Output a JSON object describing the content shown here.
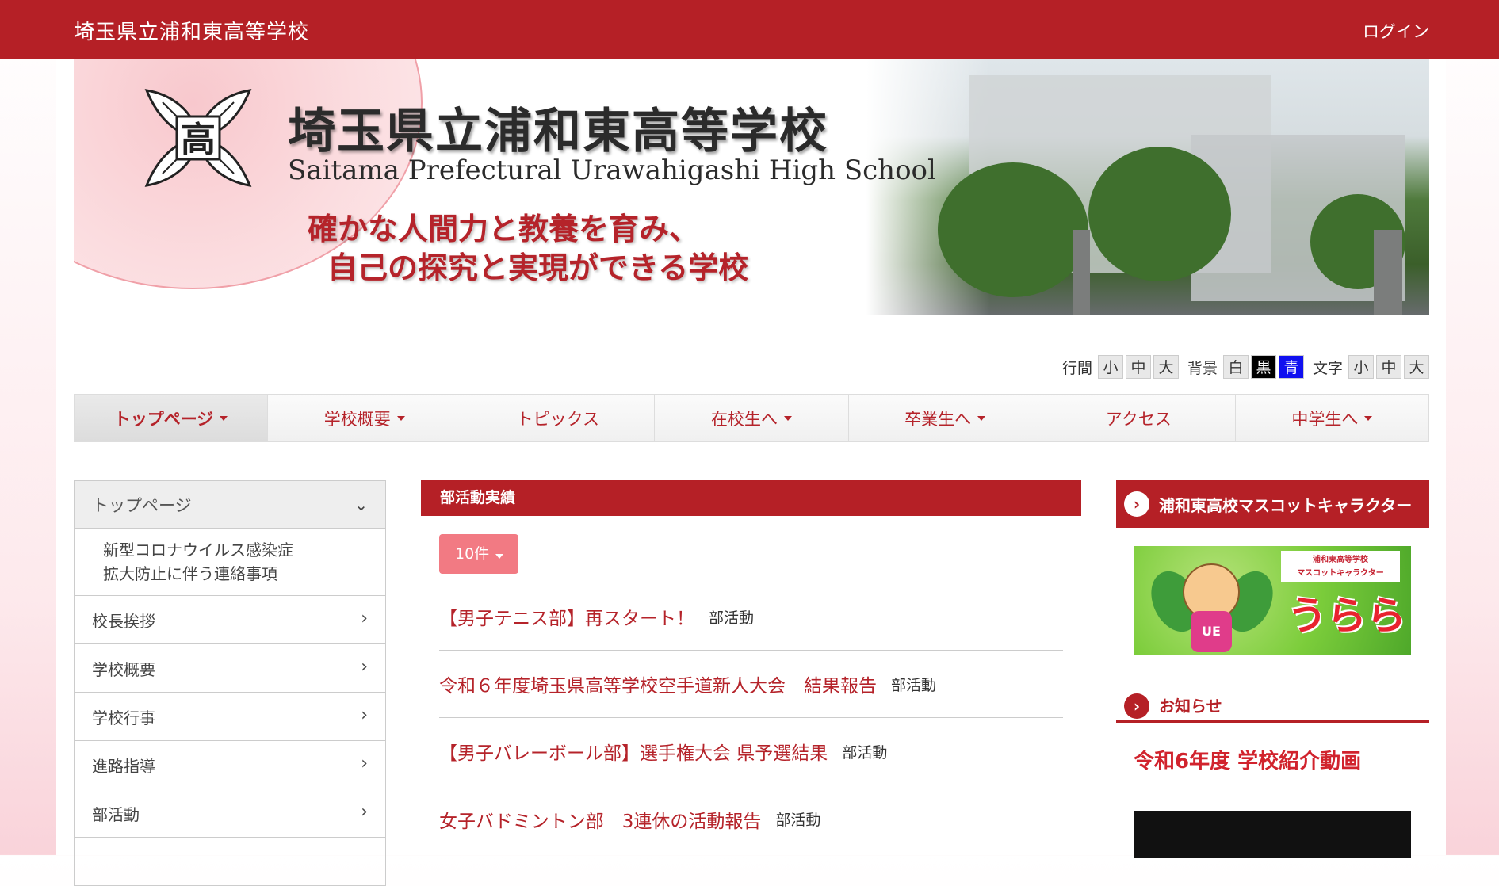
{
  "header": {
    "site_title": "埼玉県立浦和東高等学校",
    "login": "ログイン"
  },
  "banner": {
    "title_ja": "埼玉県立浦和東高等学校",
    "title_en": "Saitama Prefectural Urawahigashi High School",
    "motto_line1": "確かな人間力と教養を育み、",
    "motto_line2": "自己の探究と実現ができる学校",
    "emblem_char": "高"
  },
  "accessibility": {
    "line_label": "行間",
    "line_options": [
      "小",
      "中",
      "大"
    ],
    "bg_label": "背景",
    "bg_options": [
      "白",
      "黒",
      "青"
    ],
    "text_label": "文字",
    "text_options": [
      "小",
      "中",
      "大"
    ]
  },
  "nav": {
    "items": [
      {
        "label": "トップページ",
        "dropdown": true
      },
      {
        "label": "学校概要",
        "dropdown": true
      },
      {
        "label": "トピックス",
        "dropdown": false
      },
      {
        "label": "在校生へ",
        "dropdown": true
      },
      {
        "label": "卒業生へ",
        "dropdown": true
      },
      {
        "label": "アクセス",
        "dropdown": false
      },
      {
        "label": "中学生へ",
        "dropdown": true
      }
    ]
  },
  "sidebar": {
    "head": "トップページ",
    "sub_line1": "新型コロナウイルス感染症",
    "sub_line2": "拡大防止に伴う連絡事項",
    "items": [
      "校長挨拶",
      "学校概要",
      "学校行事",
      "進路指導",
      "部活動"
    ]
  },
  "main": {
    "head": "部活動実績",
    "count_label": "10件",
    "entries": [
      {
        "title": "【男子テニス部】再スタート！",
        "category": "部活動"
      },
      {
        "title": "令和６年度埼玉県高等学校空手道新人大会　結果報告",
        "category": "部活動"
      },
      {
        "title": "【男子バレーボール部】選手権大会 県予選結果",
        "category": "部活動"
      },
      {
        "title": "女子バドミントン部　3連休の活動報告",
        "category": "部活動"
      }
    ]
  },
  "right": {
    "mascot_head": "浦和東高校マスコットキャラクター",
    "mascot_tag_line1": "浦和東高等学校",
    "mascot_tag_line2": "マスコットキャラクター",
    "mascot_name": "うらら",
    "mascot_badge": "UE",
    "news_head": "お知らせ",
    "news_title": "令和6年度 学校紹介動画"
  },
  "colors": {
    "brand_red": "#b52026",
    "link_red": "#b5232a",
    "count_button": "#f27a83"
  }
}
